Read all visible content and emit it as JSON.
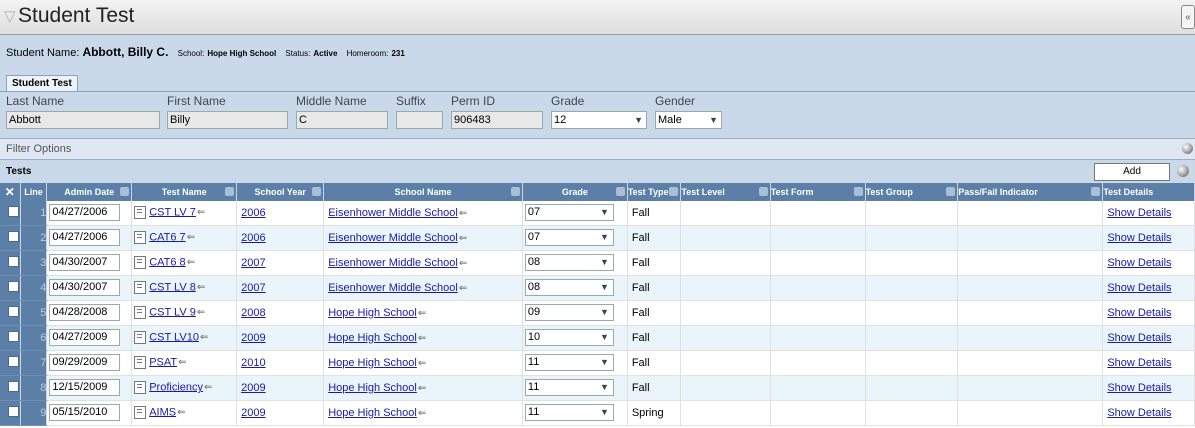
{
  "page": {
    "title": "Student Test"
  },
  "student": {
    "name_label": "Student Name:",
    "name_value": "Abbott, Billy C.",
    "school_label": "School:",
    "school_value": "Hope High School",
    "status_label": "Status:",
    "status_value": "Active",
    "homeroom_label": "Homeroom:",
    "homeroom_value": "231"
  },
  "tab": {
    "label": "Student Test"
  },
  "demographics": {
    "last_name_label": "Last Name",
    "last_name": "Abbott",
    "first_name_label": "First Name",
    "first_name": "Billy",
    "middle_name_label": "Middle Name",
    "middle_name": "C",
    "suffix_label": "Suffix",
    "suffix": "",
    "perm_id_label": "Perm ID",
    "perm_id": "906483",
    "grade_label": "Grade",
    "grade": "12",
    "gender_label": "Gender",
    "gender": "Male"
  },
  "filter": {
    "label": "Filter Options"
  },
  "tests": {
    "section_label": "Tests",
    "add_label": "Add",
    "columns": [
      "✕",
      "Line",
      "Admin Date",
      "Test Name",
      "School Year",
      "School Name",
      "Grade",
      "Test Type",
      "Test Level",
      "Test Form",
      "Test Group",
      "Pass/Fail Indicator",
      "Test Details"
    ],
    "rows": [
      {
        "line": "1",
        "admin_date": "04/27/2006",
        "test_name": "CST LV 7",
        "school_year": "2006",
        "school_name": "Eisenhower Middle School",
        "grade": "07",
        "test_type": "Fall",
        "test_level": "",
        "test_form": "",
        "test_group": "",
        "pass_fail": "",
        "details": "Show Details"
      },
      {
        "line": "2",
        "admin_date": "04/27/2006",
        "test_name": "CAT6 7",
        "school_year": "2006",
        "school_name": "Eisenhower Middle School",
        "grade": "07",
        "test_type": "Fall",
        "test_level": "",
        "test_form": "",
        "test_group": "",
        "pass_fail": "",
        "details": "Show Details"
      },
      {
        "line": "3",
        "admin_date": "04/30/2007",
        "test_name": "CAT6 8",
        "school_year": "2007",
        "school_name": "Eisenhower Middle School",
        "grade": "08",
        "test_type": "Fall",
        "test_level": "",
        "test_form": "",
        "test_group": "",
        "pass_fail": "",
        "details": "Show Details"
      },
      {
        "line": "4",
        "admin_date": "04/30/2007",
        "test_name": "CST LV 8",
        "school_year": "2007",
        "school_name": "Eisenhower Middle School",
        "grade": "08",
        "test_type": "Fall",
        "test_level": "",
        "test_form": "",
        "test_group": "",
        "pass_fail": "",
        "details": "Show Details"
      },
      {
        "line": "5",
        "admin_date": "04/28/2008",
        "test_name": "CST LV 9",
        "school_year": "2008",
        "school_name": "Hope High School",
        "grade": "09",
        "test_type": "Fall",
        "test_level": "",
        "test_form": "",
        "test_group": "",
        "pass_fail": "",
        "details": "Show Details"
      },
      {
        "line": "6",
        "admin_date": "04/27/2009",
        "test_name": "CST LV10",
        "school_year": "2009",
        "school_name": "Hope High School",
        "grade": "10",
        "test_type": "Fall",
        "test_level": "",
        "test_form": "",
        "test_group": "",
        "pass_fail": "",
        "details": "Show Details"
      },
      {
        "line": "7",
        "admin_date": "09/29/2009",
        "test_name": "PSAT",
        "school_year": "2010",
        "school_name": "Hope High School",
        "grade": "11",
        "test_type": "Fall",
        "test_level": "",
        "test_form": "",
        "test_group": "",
        "pass_fail": "",
        "details": "Show Details"
      },
      {
        "line": "8",
        "admin_date": "12/15/2009",
        "test_name": "Proficiency",
        "school_year": "2009",
        "school_name": "Hope High School",
        "grade": "11",
        "test_type": "Fall",
        "test_level": "",
        "test_form": "",
        "test_group": "",
        "pass_fail": "",
        "details": "Show Details"
      },
      {
        "line": "9",
        "admin_date": "05/15/2010",
        "test_name": "AIMS",
        "school_year": "2009",
        "school_name": "Hope High School",
        "grade": "11",
        "test_type": "Spring",
        "test_level": "",
        "test_form": "",
        "test_group": "",
        "pass_fail": "",
        "details": "Show Details"
      }
    ]
  },
  "colors": {
    "header_blue": "#5b7fa6",
    "panel_blue": "#cad9e9",
    "link_blue": "#1a1aa6",
    "row_alt": "#e9f5fa"
  },
  "icons": {
    "filter": "funnel-icon",
    "expand": "expand-icon",
    "note": "note-icon",
    "return": "return-arrow-icon"
  }
}
